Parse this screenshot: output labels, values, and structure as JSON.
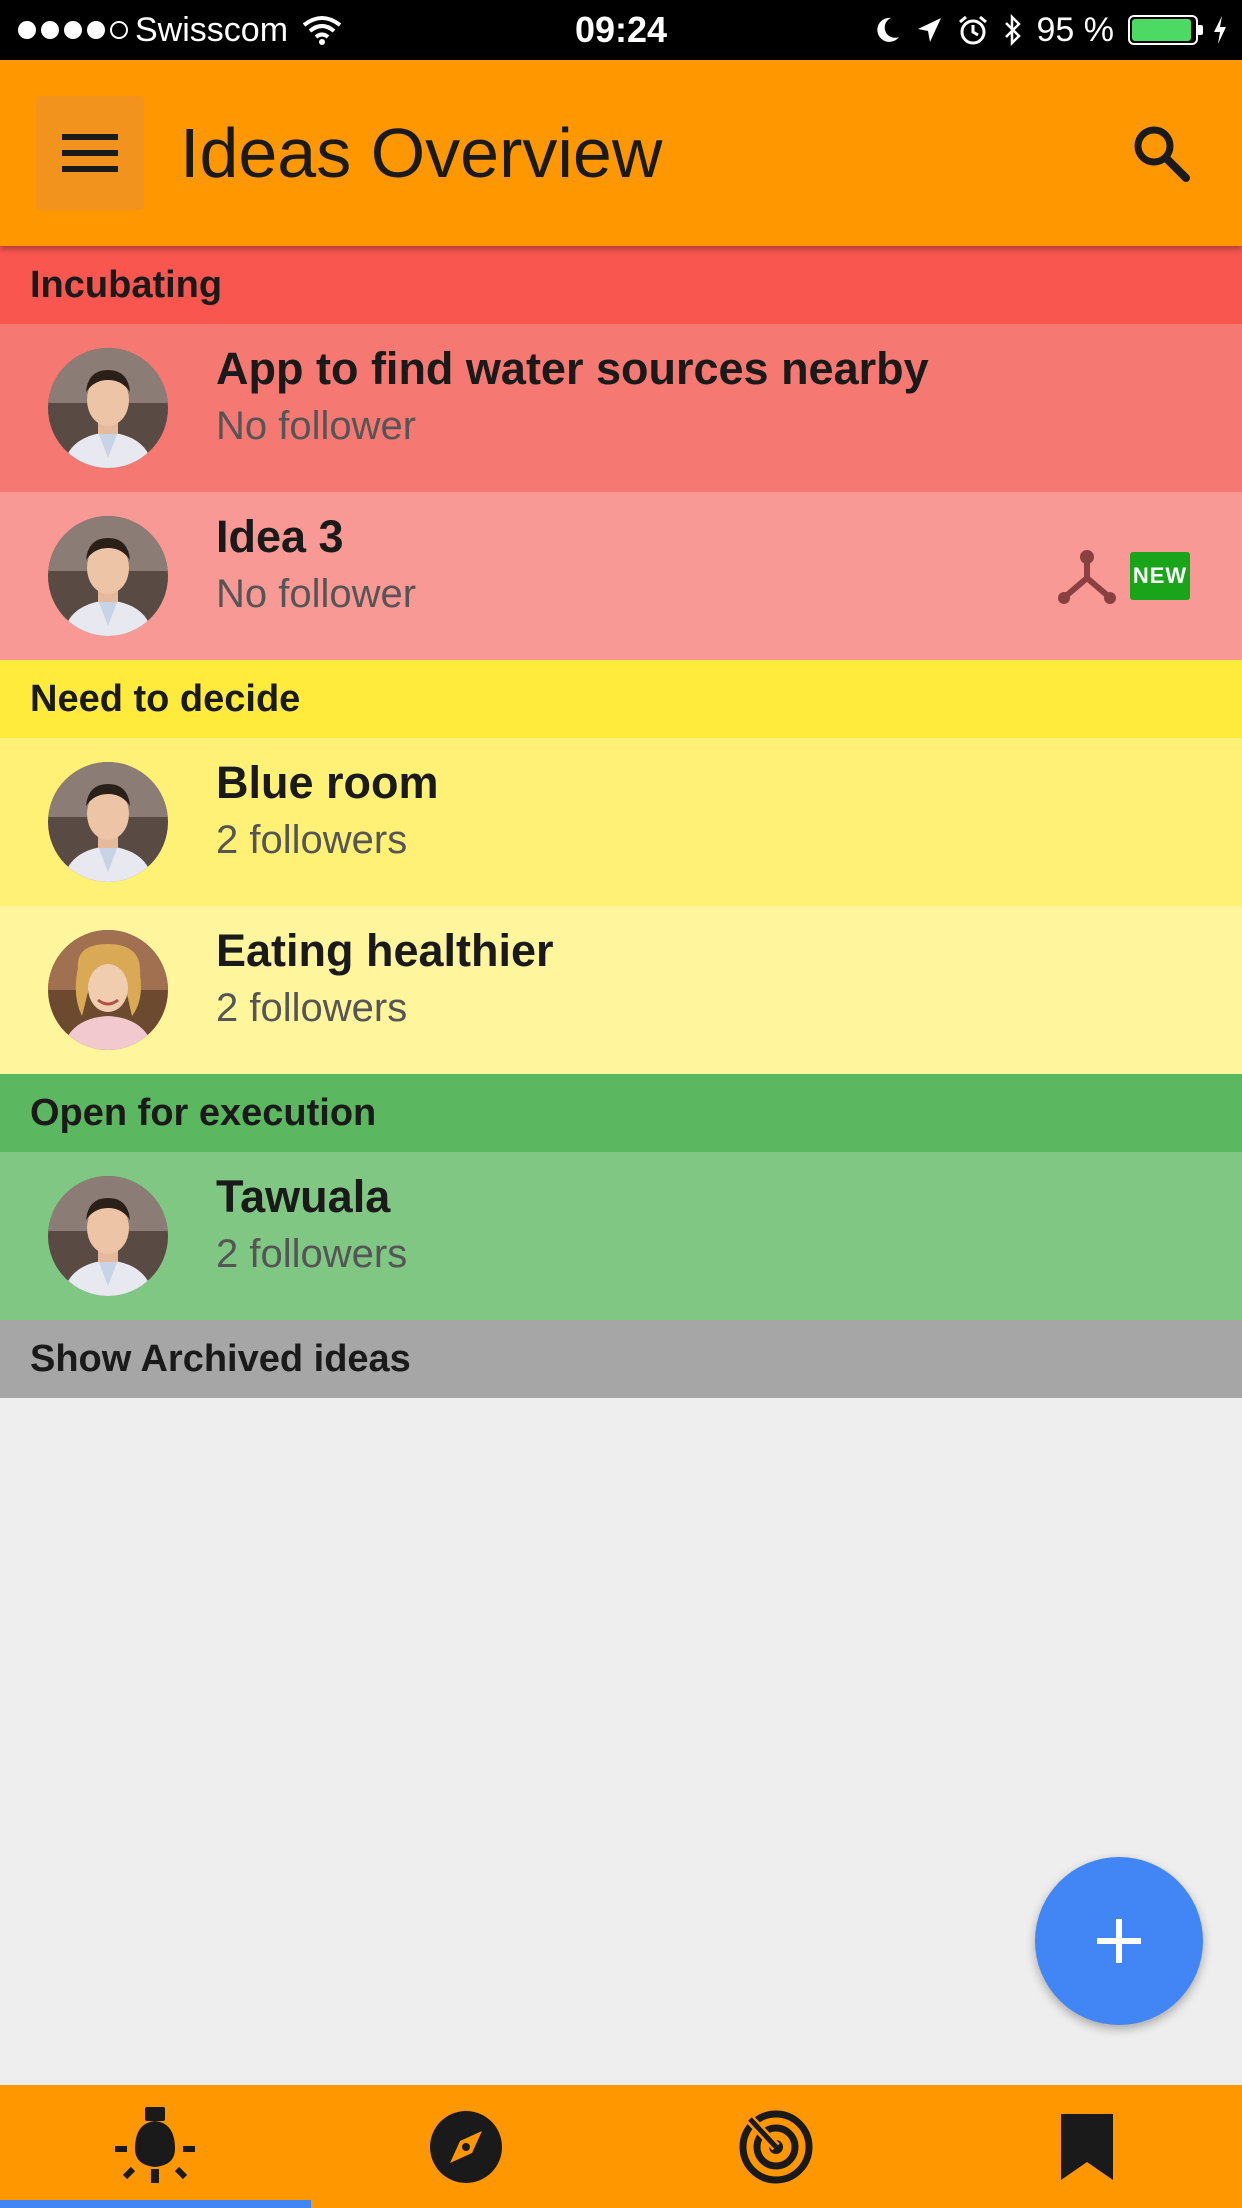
{
  "status_bar": {
    "carrier": "Swisscom",
    "time": "09:24",
    "battery": "95 %",
    "battery_level": 0.95
  },
  "app_bar": {
    "title": "Ideas Overview",
    "menu_icon": "hamburger-icon",
    "search_icon": "search-icon"
  },
  "colors": {
    "app_bar": "#ff9800",
    "incubating_header": "#f8564f",
    "incubating_row_1": "#f57872",
    "incubating_row_2": "#f99995",
    "decide_header": "#ffeb3b",
    "decide_row_1": "#fff176",
    "decide_row_2": "#fff59d",
    "execution_header": "#5cb860",
    "execution_row_1": "#81c784",
    "archived_header": "#a6a6a6",
    "fab": "#4285f4",
    "new_badge": "#1aa41a"
  },
  "sections": [
    {
      "title": "Incubating",
      "ideas": [
        {
          "title": "App to find water sources nearby",
          "followers": "No follower"
        },
        {
          "title": "Idea 3",
          "followers": "No follower",
          "badge": "NEW",
          "extra_icon": "fork-icon"
        }
      ]
    },
    {
      "title": "Need to decide",
      "ideas": [
        {
          "title": "Blue room",
          "followers": "2 followers"
        },
        {
          "title": "Eating healthier",
          "followers": "2 followers"
        }
      ]
    },
    {
      "title": "Open for execution",
      "ideas": [
        {
          "title": "Tawuala",
          "followers": "2 followers"
        }
      ]
    }
  ],
  "archived": {
    "label": "Show Archived ideas"
  },
  "fab": {
    "icon": "plus-icon"
  },
  "bottom_nav": [
    {
      "icon": "lightbulb-icon",
      "active": true
    },
    {
      "icon": "compass-icon",
      "active": false
    },
    {
      "icon": "radar-icon",
      "active": false
    },
    {
      "icon": "bookmark-icon",
      "active": false
    }
  ]
}
